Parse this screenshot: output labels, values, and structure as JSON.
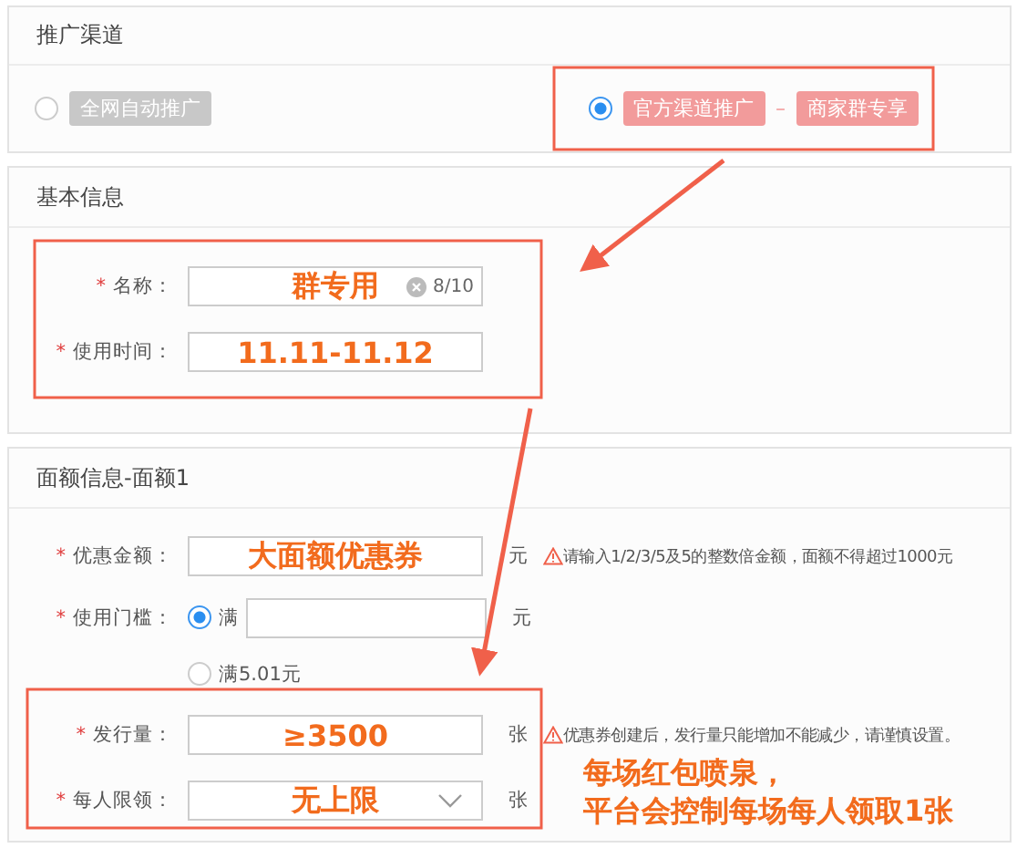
{
  "sections": [
    {
      "title": "推广渠道",
      "kind": "channels",
      "options": [
        {
          "selected": false,
          "tags": [
            "全网自动推广"
          ]
        },
        {
          "selected": true,
          "tags": [
            "官方渠道推广",
            "商家群专享"
          ],
          "separator": "–"
        }
      ]
    },
    {
      "title": "基本信息",
      "kind": "fields",
      "rows": [
        {
          "kind": "text",
          "required_mark": "*",
          "label": "名称：",
          "value": "群专用",
          "clearable": true,
          "count": "8/10"
        },
        {
          "kind": "text",
          "required_mark": "*",
          "label": "使用时间：",
          "value": "11.11-11.12"
        }
      ]
    },
    {
      "title": "面额信息-面额1",
      "kind": "fields",
      "rows": [
        {
          "kind": "text",
          "required_mark": "*",
          "label": "优惠金额：",
          "value": "大面额优惠券",
          "unit": "元",
          "warning": "请输入1/2/3/5及5的整数倍金额，面额不得超过1000元"
        },
        {
          "kind": "threshold",
          "required_mark": "*",
          "label": "使用门槛：",
          "options": [
            {
              "selected": true,
              "label": "满",
              "unit": "元"
            },
            {
              "selected": false,
              "label": "满5.01元"
            }
          ]
        },
        {
          "kind": "text",
          "required_mark": "*",
          "label": "发行量：",
          "value": "≥3500",
          "unit": "张",
          "warning": "优惠券创建后，发行量只能增加不能减少，请谨慎设置。"
        },
        {
          "kind": "select",
          "required_mark": "*",
          "label": "每人限领：",
          "value": "无上限",
          "unit": "张"
        }
      ]
    }
  ],
  "annotation": {
    "lines": [
      "每场红包喷泉，",
      "平台会控制每场每人领取1张"
    ]
  }
}
